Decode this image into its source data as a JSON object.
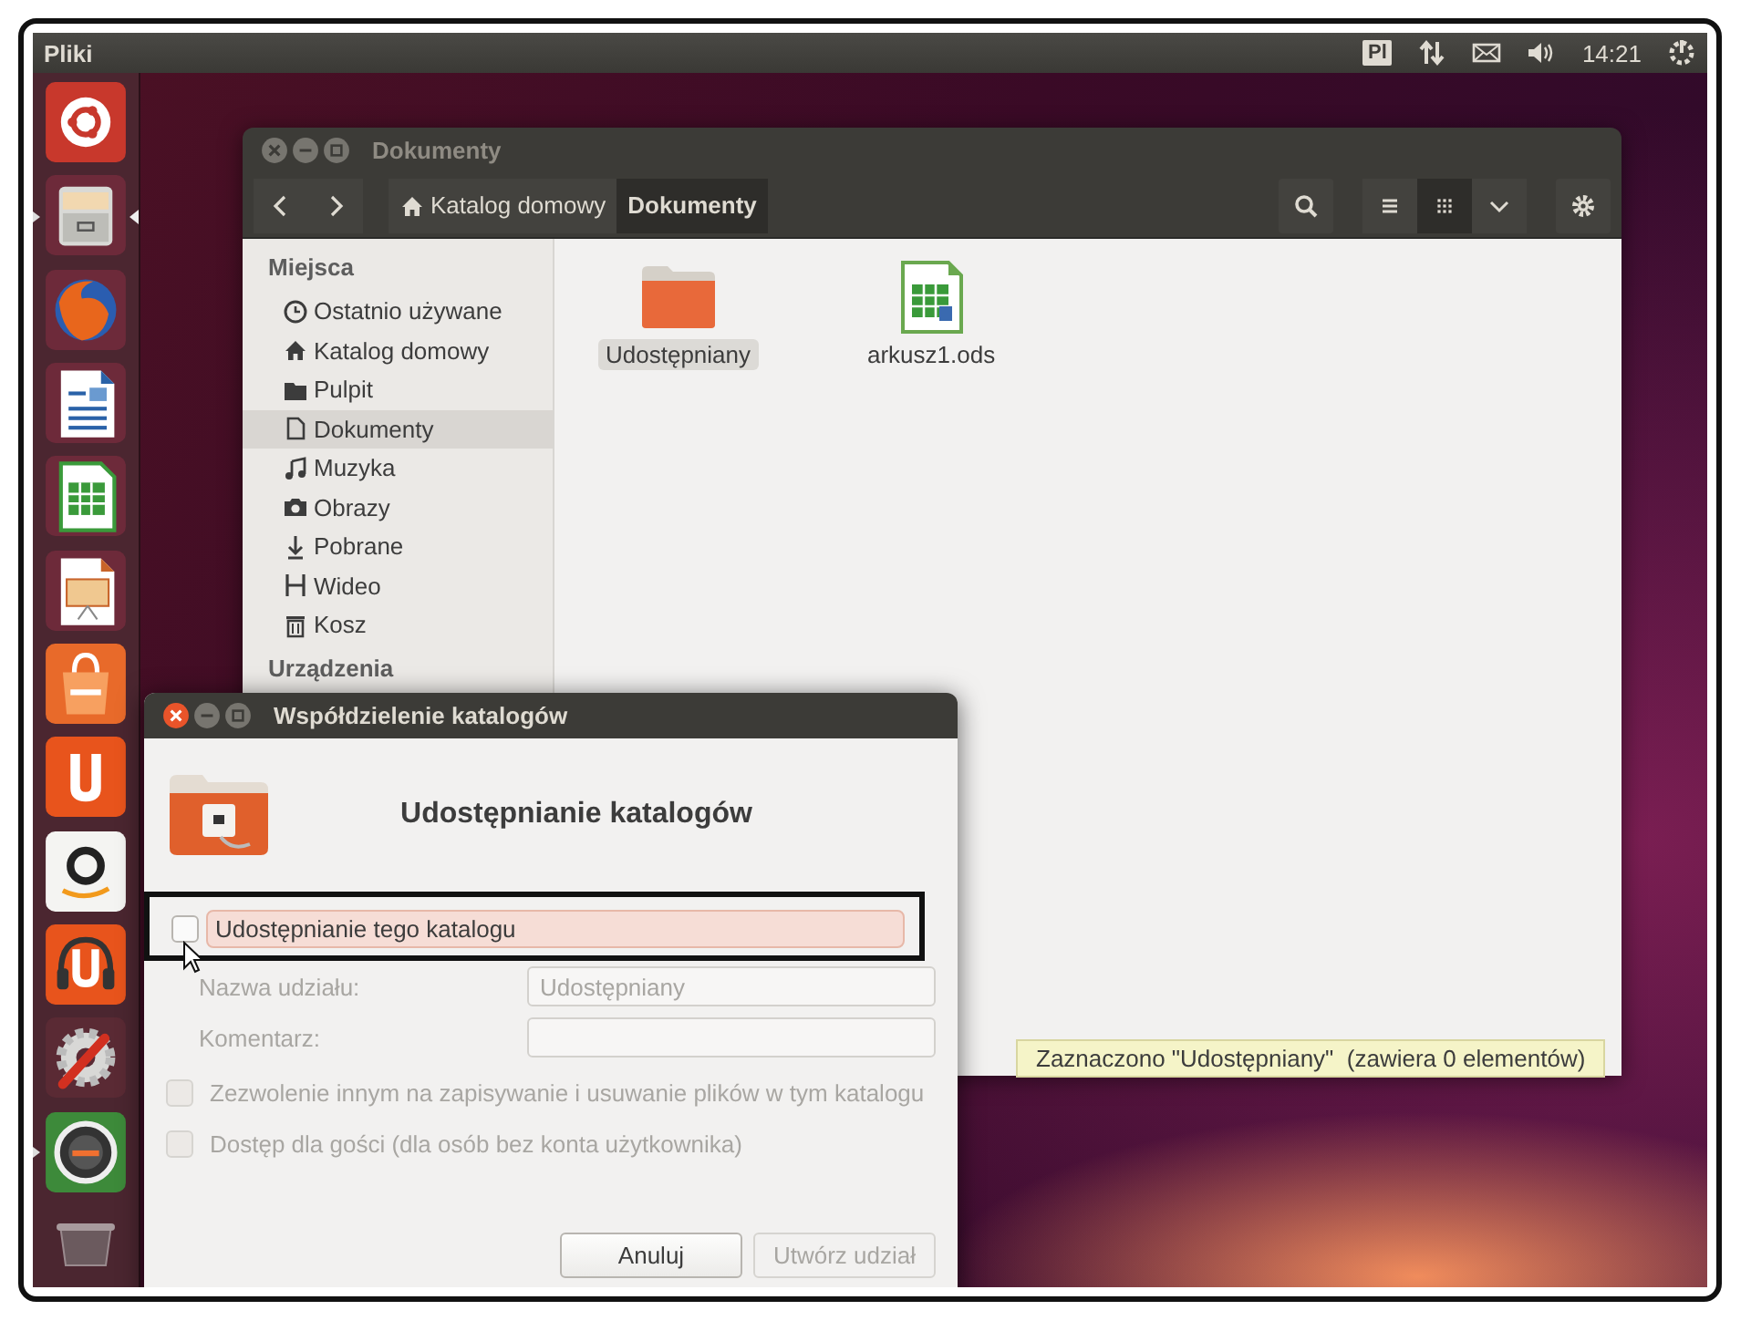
{
  "top_panel": {
    "app_title": "Pliki",
    "keyboard_layout": "Pl",
    "clock": "14:21"
  },
  "launcher": [
    {
      "kind": "dash",
      "running": false,
      "focused": false
    },
    {
      "kind": "files",
      "running": true,
      "focused": true
    },
    {
      "kind": "browser",
      "running": false,
      "focused": false
    },
    {
      "kind": "writer",
      "running": false,
      "focused": false
    },
    {
      "kind": "calc",
      "running": false,
      "focused": false
    },
    {
      "kind": "impress",
      "running": false,
      "focused": false
    },
    {
      "kind": "software",
      "running": false,
      "focused": false
    },
    {
      "kind": "cloud",
      "running": false,
      "focused": false
    },
    {
      "kind": "shop",
      "running": false,
      "focused": false
    },
    {
      "kind": "music",
      "running": false,
      "focused": false
    },
    {
      "kind": "settings",
      "running": false,
      "focused": false
    },
    {
      "kind": "updater",
      "running": true,
      "focused": false
    },
    {
      "kind": "trash",
      "running": false,
      "focused": false
    }
  ],
  "file_window": {
    "title": "Dokumenty",
    "breadcrumbs": [
      {
        "label": "Katalog domowy",
        "home": true,
        "selected": false
      },
      {
        "label": "Dokumenty",
        "home": false,
        "selected": true
      }
    ],
    "view_modes": [
      {
        "kind": "list",
        "selected": false
      },
      {
        "kind": "grid",
        "selected": true
      }
    ],
    "sidebar": [
      {
        "heading": "Miejsca",
        "items": [
          {
            "label": "Ostatnio używane",
            "kind": "recent",
            "selected": false
          },
          {
            "label": "Katalog domowy",
            "kind": "home",
            "selected": false
          },
          {
            "label": "Pulpit",
            "kind": "desktop",
            "selected": false
          },
          {
            "label": "Dokumenty",
            "kind": "documents",
            "selected": true
          },
          {
            "label": "Muzyka",
            "kind": "music",
            "selected": false
          },
          {
            "label": "Obrazy",
            "kind": "pictures",
            "selected": false
          },
          {
            "label": "Pobrane",
            "kind": "downloads",
            "selected": false
          },
          {
            "label": "Wideo",
            "kind": "videos",
            "selected": false
          },
          {
            "label": "Kosz",
            "kind": "trash",
            "selected": false
          }
        ]
      },
      {
        "heading": "Urządzenia"
      }
    ],
    "files": [
      {
        "name": "Udostępniany",
        "kind": "folder",
        "selected": true
      },
      {
        "name": "arkusz1.ods",
        "kind": "spreadsheet",
        "selected": false
      }
    ],
    "status": "Zaznaczono \"Udostępniany\"  (zawiera 0 elementów)"
  },
  "dialog": {
    "title": "Współdzielenie katalogów",
    "heading": "Udostępnianie katalogów",
    "share_checkbox": {
      "label": "Udostępnianie tego katalogu",
      "checked": false,
      "disabled": false,
      "hovered": true
    },
    "fields": [
      {
        "label": "Nazwa udziału:",
        "value": "Udostępniany",
        "disabled": true
      },
      {
        "label": "Komentarz:",
        "disabled": true
      }
    ],
    "options": [
      {
        "label": "Zezwolenie innym na zapisywanie i usuwanie plików w tym katalogu",
        "checked": false,
        "disabled": true
      },
      {
        "label": "Dostęp dla gości (dla osób bez konta użytkownika)",
        "checked": false,
        "disabled": true
      }
    ],
    "buttons": [
      {
        "label": "Anuluj",
        "disabled": false
      },
      {
        "label": "Utwórz udział",
        "disabled": true
      }
    ]
  }
}
